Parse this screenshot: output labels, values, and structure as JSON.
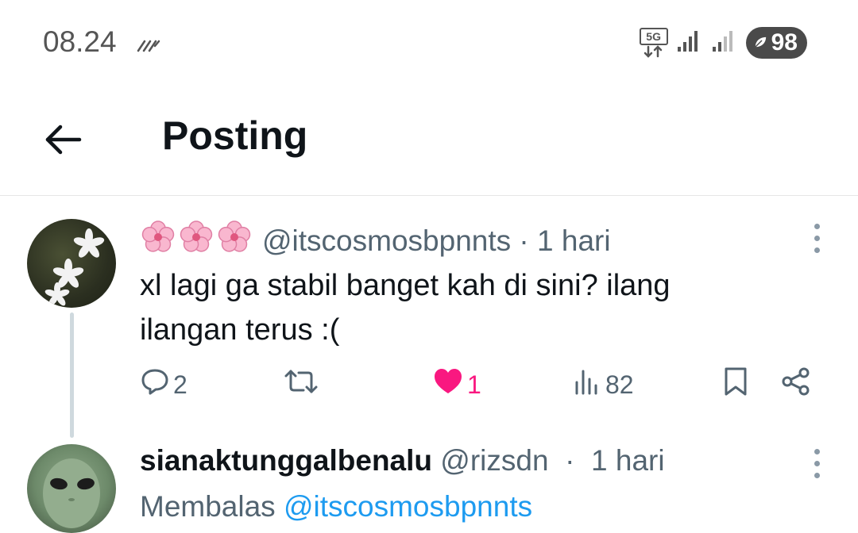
{
  "status_bar": {
    "time": "08.24",
    "network": "5G",
    "battery": "98",
    "icons": [
      "data-saver-icon",
      "5g-icon",
      "signal-icon",
      "signal-weak-icon",
      "battery-saver-icon"
    ]
  },
  "header": {
    "title": "Posting",
    "back_icon": "arrow-left-icon"
  },
  "post": {
    "display_name_emoji": "🌸🌸🌸",
    "handle": "@itscosmosbpnnts",
    "time": "1 hari",
    "text": "xl lagi ga stabil banget kah di sini? ilang ilangan terus :(",
    "actions": {
      "replies": "2",
      "reposts": "",
      "likes": "1",
      "views": "82"
    },
    "liked": true,
    "like_color": "#f91880"
  },
  "reply": {
    "display_name": "sianaktunggalbenalu",
    "handle": "@rizsdn",
    "time": "1 hari",
    "replying_label": "Membalas",
    "replying_to": "@itscosmosbpnnts"
  },
  "colors": {
    "accent": "#1d9bf0",
    "muted": "#536471"
  }
}
